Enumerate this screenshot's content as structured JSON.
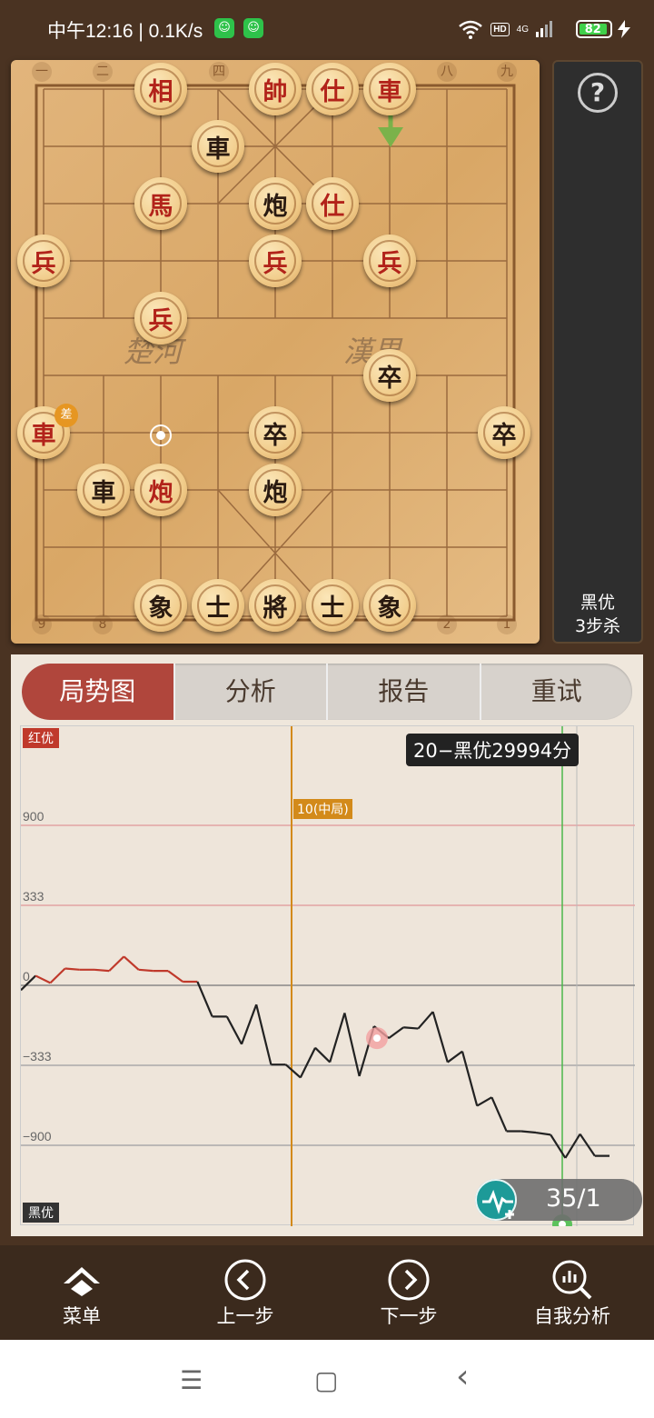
{
  "status": {
    "time_speed": "中午12:16 | 0.1K/s",
    "hd": "HD",
    "net": "4G",
    "battery": "82",
    "app_badge": "☺"
  },
  "board": {
    "files_top": [
      "一",
      "二",
      "",
      "四",
      "",
      "",
      "",
      "八",
      "九"
    ],
    "files_bottom": [
      "9",
      "8",
      "",
      "",
      "",
      "",
      "",
      "2",
      "1"
    ],
    "river_left": "楚河",
    "river_right": "漢界",
    "pieces": [
      {
        "name": "red-xiang-1",
        "char": "相",
        "side": "red"
      },
      {
        "name": "red-shuai",
        "char": "帥",
        "side": "red"
      },
      {
        "name": "red-shi-1",
        "char": "仕",
        "side": "red"
      },
      {
        "name": "red-ju-1",
        "char": "車",
        "side": "red"
      },
      {
        "name": "black-ju-1",
        "char": "車",
        "side": "black"
      },
      {
        "name": "red-ma",
        "char": "馬",
        "side": "red"
      },
      {
        "name": "black-pao-1",
        "char": "炮",
        "side": "black"
      },
      {
        "name": "red-shi-2",
        "char": "仕",
        "side": "red"
      },
      {
        "name": "red-bing-1",
        "char": "兵",
        "side": "red"
      },
      {
        "name": "red-bing-2",
        "char": "兵",
        "side": "red"
      },
      {
        "name": "red-bing-3",
        "char": "兵",
        "side": "red"
      },
      {
        "name": "red-bing-4",
        "char": "兵",
        "side": "red"
      },
      {
        "name": "black-zu-1",
        "char": "卒",
        "side": "black"
      },
      {
        "name": "red-ju-2",
        "char": "車",
        "side": "red"
      },
      {
        "name": "black-zu-2",
        "char": "卒",
        "side": "black"
      },
      {
        "name": "black-zu-3",
        "char": "卒",
        "side": "black"
      },
      {
        "name": "black-ju-2",
        "char": "車",
        "side": "black"
      },
      {
        "name": "red-pao",
        "char": "炮",
        "side": "red"
      },
      {
        "name": "black-pao-2",
        "char": "炮",
        "side": "black"
      },
      {
        "name": "black-xiang-1",
        "char": "象",
        "side": "black"
      },
      {
        "name": "black-shi-1",
        "char": "士",
        "side": "black"
      },
      {
        "name": "black-jiang",
        "char": "將",
        "side": "black"
      },
      {
        "name": "black-shi-2",
        "char": "士",
        "side": "black"
      },
      {
        "name": "black-xiang-2",
        "char": "象",
        "side": "black"
      }
    ],
    "diff_badge": "差"
  },
  "side": {
    "help": "?",
    "eval_line1": "黑优",
    "eval_line2": "3步杀"
  },
  "tabs": [
    "局势图",
    "分析",
    "报告",
    "重试"
  ],
  "chart": {
    "top_label": "红优",
    "bottom_label": "黑优",
    "tooltip": "20−黑优29994分",
    "phase_tag": "10(中局)",
    "y_ticks": [
      "900",
      "333",
      "0",
      "−333",
      "−900"
    ],
    "move_value": "35/1"
  },
  "chart_data": {
    "type": "line",
    "title": "",
    "xlabel": "",
    "ylabel": "",
    "y_ticks": [
      900,
      333,
      0,
      -333,
      -900
    ],
    "phase_marker_x": 10,
    "current_marker_x": 35,
    "series": [
      {
        "values": [
          -20,
          40,
          10,
          70,
          65,
          65,
          60,
          120,
          65,
          60,
          60,
          15,
          15,
          -130,
          -130,
          -245,
          -80,
          -330,
          -330,
          -420,
          -260,
          -320,
          -115,
          -410,
          -170,
          -220,
          -175,
          -180,
          -110,
          -320,
          -275,
          -620,
          -560,
          -800,
          -800,
          -810,
          -825,
          -990,
          -820,
          -975,
          -975
        ]
      }
    ]
  },
  "nav": {
    "menu": "菜单",
    "prev": "上一步",
    "next": "下一步",
    "analysis": "自我分析"
  },
  "sysnav": {
    "menu": "☰",
    "home": "▢",
    "back": "‹"
  },
  "colors": {
    "red_piece": "#b2231a",
    "black_piece": "#2a1a10",
    "accent_tab": "#b0463c",
    "phase_line": "#d38a1a",
    "current_line": "#4bb84b",
    "eval_red": "#c0392b",
    "eval_black": "#222222"
  }
}
